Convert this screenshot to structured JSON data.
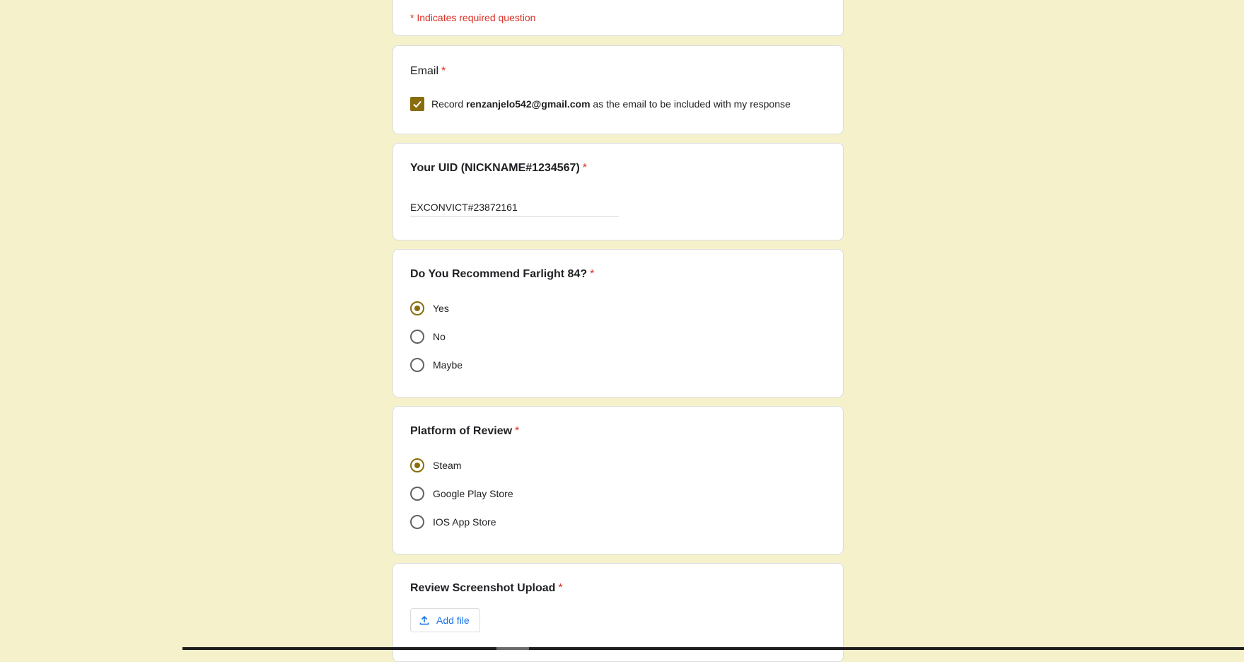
{
  "form": {
    "required_note": "* Indicates required question",
    "email": {
      "title": "Email",
      "required_mark": "*",
      "checkbox_checked": true,
      "record_prefix": "Record",
      "email_address": "renzanjelo542@gmail.com",
      "record_suffix": "as the email to be included with my response"
    },
    "uid": {
      "title": "Your UID (NICKNAME#1234567)",
      "required_mark": "*",
      "value": "EXCONVICT#23872161"
    },
    "recommend": {
      "title": "Do You Recommend Farlight 84?",
      "required_mark": "*",
      "options": [
        "Yes",
        "No",
        "Maybe"
      ],
      "selected": "Yes"
    },
    "platform": {
      "title": "Platform of Review",
      "required_mark": "*",
      "options": [
        "Steam",
        "Google Play Store",
        "IOS App Store"
      ],
      "selected": "Steam"
    },
    "upload": {
      "title": "Review Screenshot Upload",
      "required_mark": "*",
      "button_label": "Add file",
      "button_icon": "upload-icon"
    }
  },
  "colors": {
    "background": "#f5f2cb",
    "accent": "#8a6d0b",
    "required": "#d93025",
    "link_blue": "#1a73e8"
  }
}
